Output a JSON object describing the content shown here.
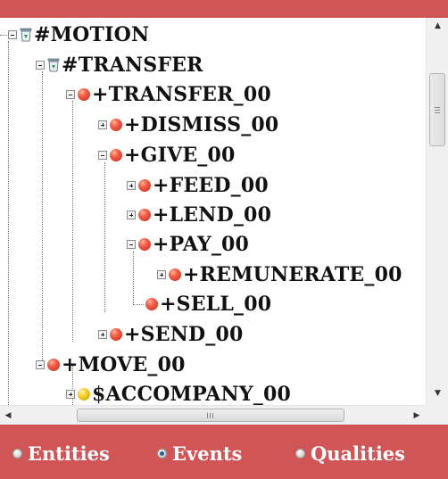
{
  "tree": [
    {
      "label": "#MOTION",
      "icon": "recycle-bin-icon",
      "toggle": "minus"
    },
    {
      "label": "#TRANSFER",
      "icon": "recycle-bin-icon",
      "toggle": "minus"
    },
    {
      "label": "+TRANSFER_00",
      "icon": "red-ball-icon",
      "toggle": "minus"
    },
    {
      "label": "+DISMISS_00",
      "icon": "red-ball-icon",
      "toggle": "plus"
    },
    {
      "label": "+GIVE_00",
      "icon": "red-ball-icon",
      "toggle": "minus"
    },
    {
      "label": "+FEED_00",
      "icon": "red-ball-icon",
      "toggle": "plus"
    },
    {
      "label": "+LEND_00",
      "icon": "red-ball-icon",
      "toggle": "plus"
    },
    {
      "label": "+PAY_00",
      "icon": "red-ball-icon",
      "toggle": "minus"
    },
    {
      "label": "+REMUNERATE_00",
      "icon": "red-ball-icon",
      "toggle": "plus"
    },
    {
      "label": "+SELL_00",
      "icon": "red-ball-icon",
      "toggle": "none"
    },
    {
      "label": "+SEND_00",
      "icon": "red-ball-icon",
      "toggle": "plus"
    },
    {
      "label": "+MOVE_00",
      "icon": "red-ball-icon",
      "toggle": "minus"
    },
    {
      "label": "$ACCOMPANY_00",
      "icon": "yellow-ball-icon",
      "toggle": "plus"
    }
  ],
  "scroll": {
    "up_arrow": "▲",
    "down_arrow": "▼",
    "left_arrow": "◀",
    "right_arrow": "▶"
  },
  "view_selector": {
    "options": [
      {
        "label": "Entities",
        "checked": false
      },
      {
        "label": "Events",
        "checked": true
      },
      {
        "label": "Qualities",
        "checked": false
      }
    ]
  },
  "colors": {
    "bar": "#cf5557",
    "red_node": "#e2452f",
    "yellow_node": "#f2cf2a",
    "selected_radio": "#2a5d9a"
  }
}
